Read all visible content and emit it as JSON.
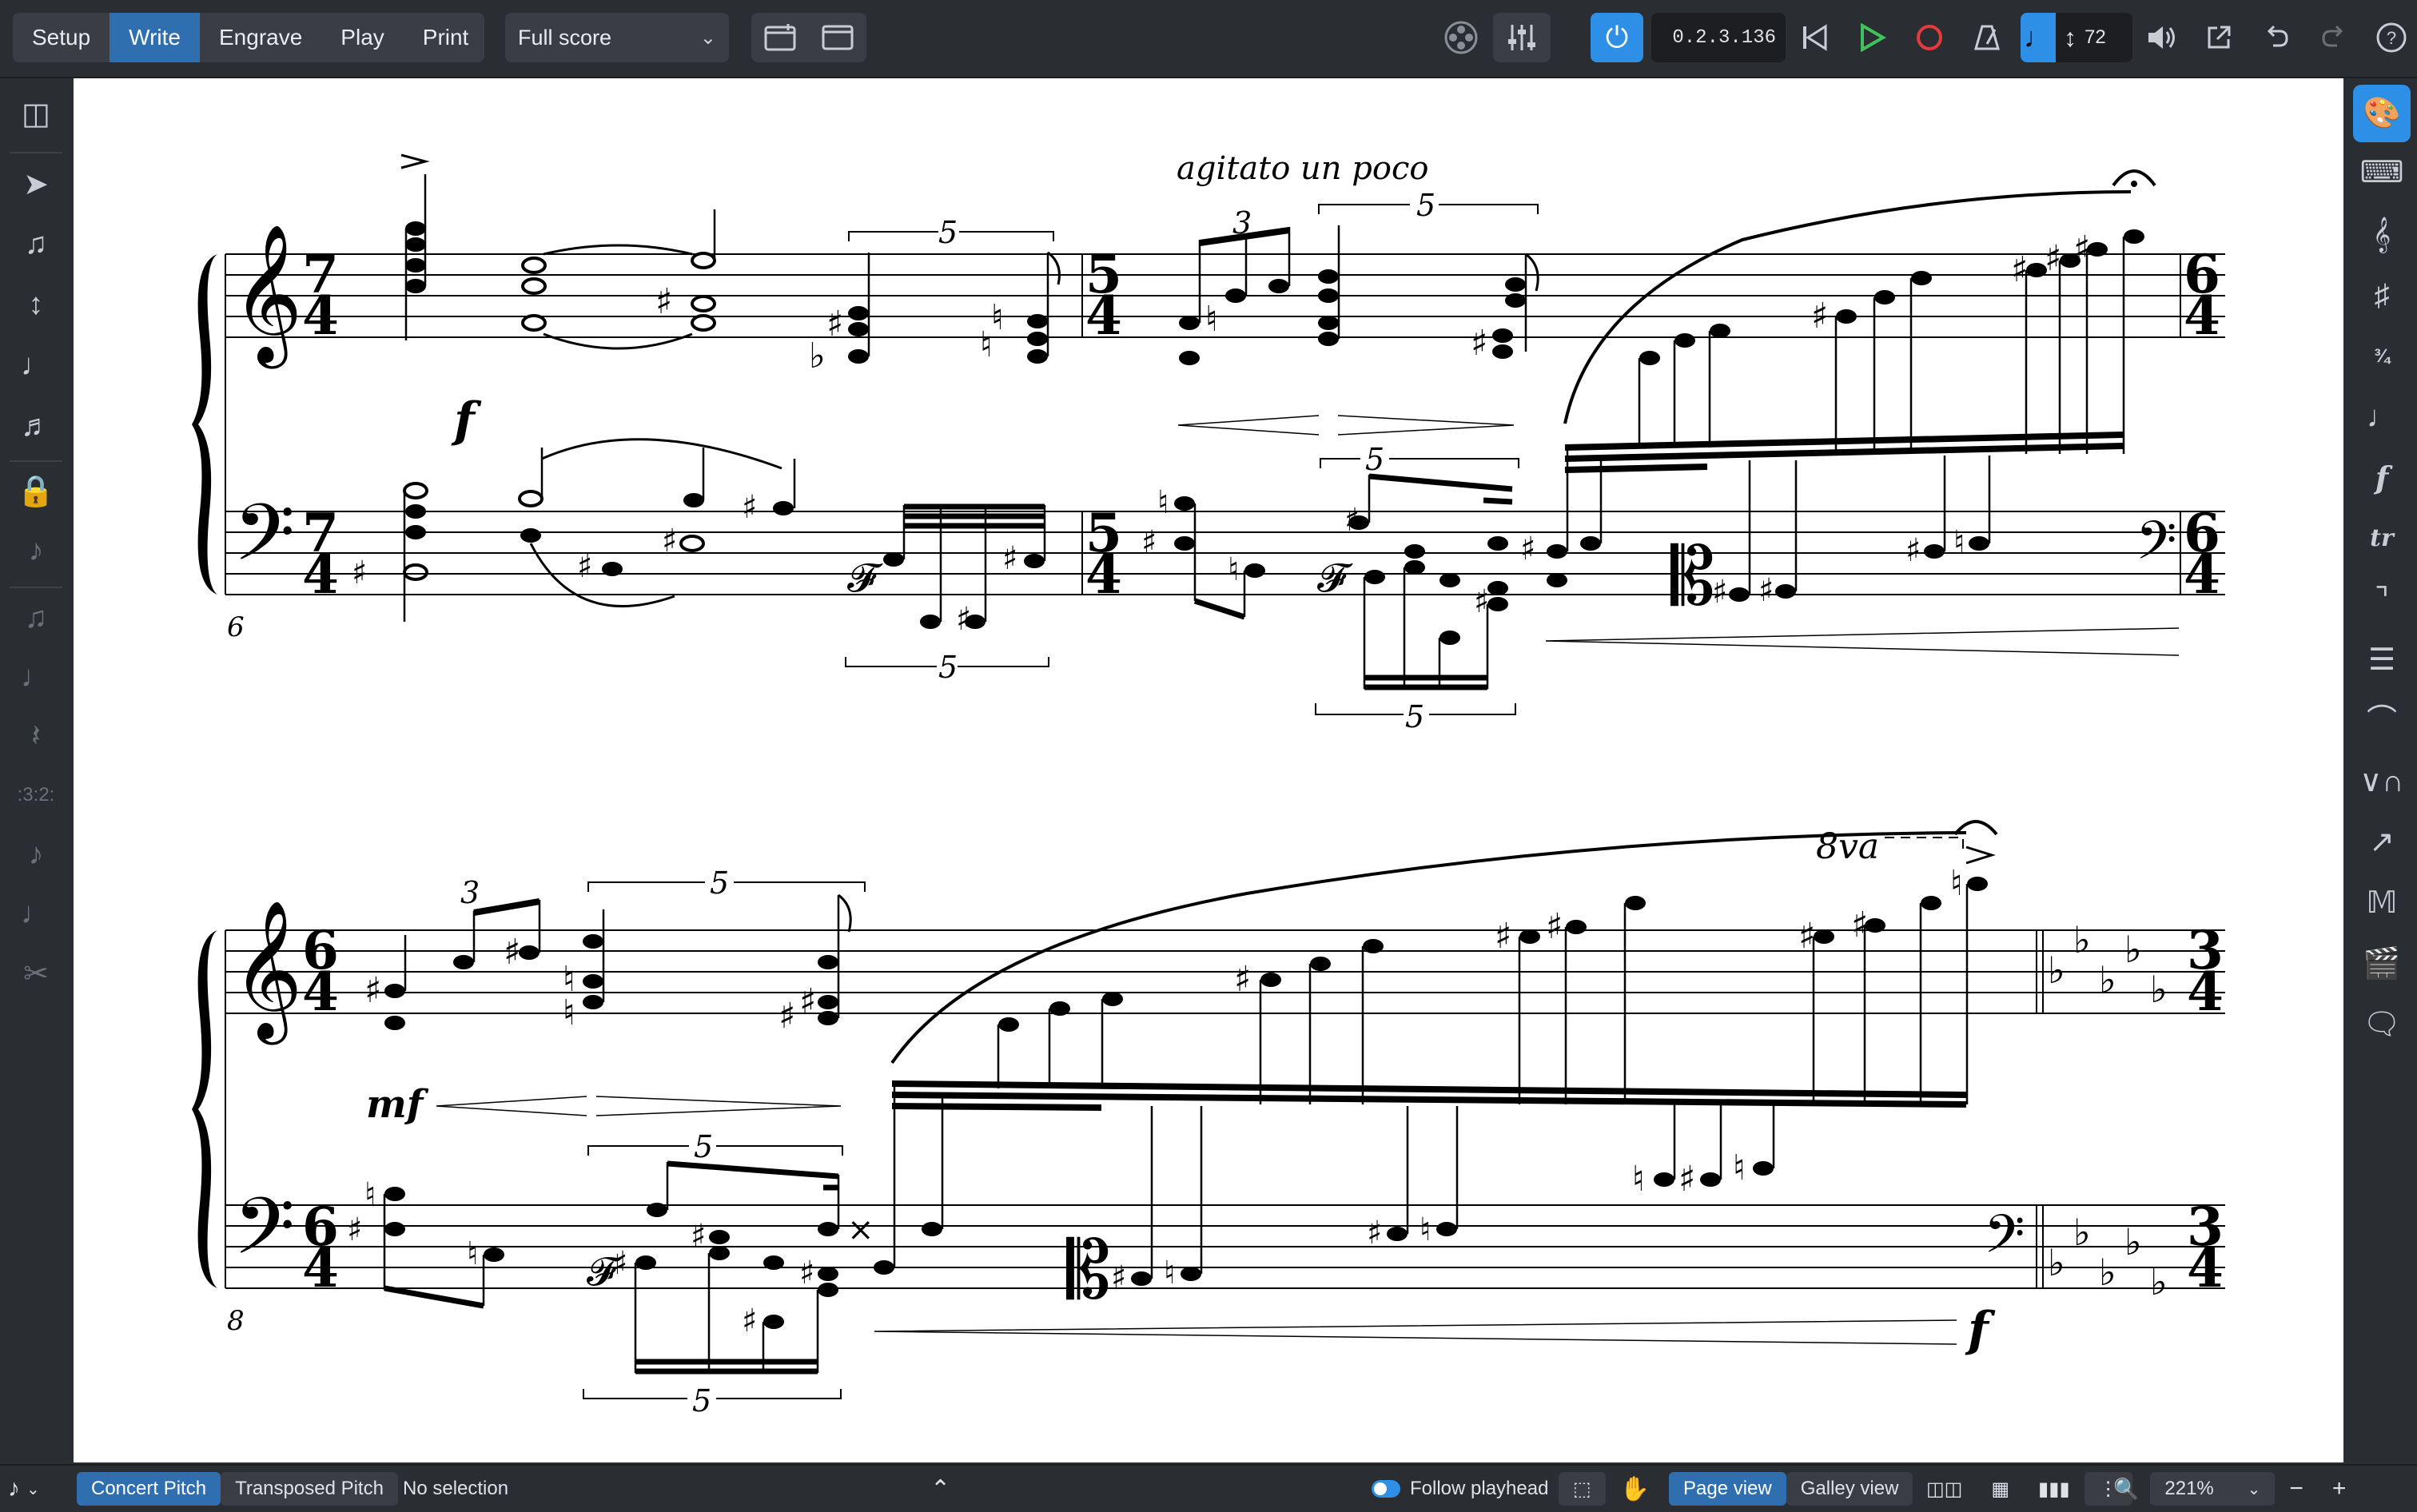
{
  "toolbar": {
    "modes": [
      "Setup",
      "Write",
      "Engrave",
      "Play",
      "Print"
    ],
    "active_mode": "Write",
    "layout_select": "Full score",
    "timecode": "0.2.3.136",
    "tempo_value": "72"
  },
  "icons": {
    "left_rail": [
      "panel-toggle-icon",
      "select-arrow-icon",
      "note-input-icon",
      "transpose-icon",
      "tremolo-icon",
      "stem-icon",
      "lock-icon",
      "grace-note-icon",
      "add-note-icon",
      "quarter-note-icon",
      "rest-icon",
      "tuplet-icon",
      "slash-note-icon",
      "tie-icon",
      "scissors-icon"
    ],
    "right_rail": [
      "palette-icon",
      "keyboard-icon",
      "clef-icon",
      "key-signature-icon",
      "time-signature-icon",
      "tempo-icon",
      "dynamics-icon",
      "ornaments-icon",
      "repeat-icon",
      "bars-barlines-icon",
      "holds-pauses-icon",
      "bowing-icon",
      "lines-icon",
      "playing-techniques-icon",
      "cue-icon",
      "comments-icon"
    ]
  },
  "score": {
    "system1": {
      "bar_number": "6",
      "expression": "agitato un poco",
      "dynamic": "f",
      "tuplets": [
        "3",
        "5",
        "5",
        "5",
        "5",
        "5"
      ],
      "time_signatures": [
        "7/4",
        "5/4",
        "6/4"
      ]
    },
    "system2": {
      "bar_number": "8",
      "dynamic_start": "mf",
      "dynamic_end": "f",
      "octave_line": "8va",
      "tuplets": [
        "3",
        "5",
        "5",
        "5"
      ],
      "time_signatures": [
        "6/4",
        "3/4"
      ]
    }
  },
  "statusbar": {
    "concert_pitch": "Concert Pitch",
    "transposed_pitch": "Transposed Pitch",
    "selection": "No selection",
    "follow_playhead": "Follow playhead",
    "page_view": "Page view",
    "galley_view": "Galley view",
    "zoom": "221%"
  },
  "colors": {
    "accent": "#2e8fe6",
    "active_mode": "#2f6fb0",
    "record": "#e23b3b",
    "play": "#3fc25a"
  }
}
